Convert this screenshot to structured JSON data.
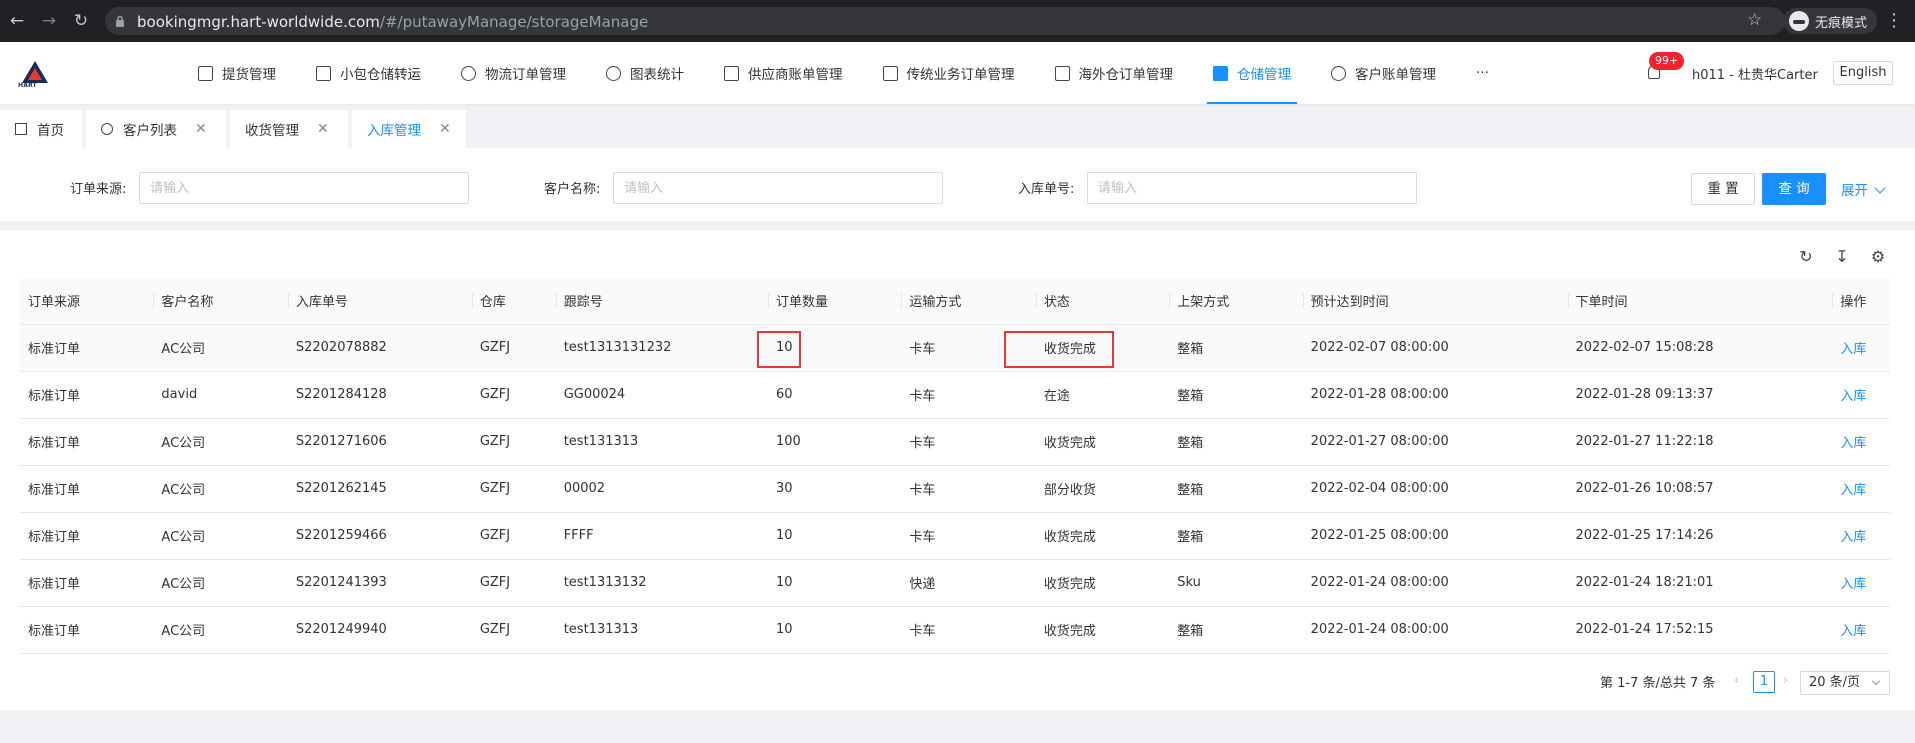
{
  "browser": {
    "url_host": "bookingmgr.hart-worldwide.com",
    "url_path": "/#/putawayManage/storageManage",
    "incognito_label": "无痕模式"
  },
  "header": {
    "logo_text": "HART",
    "nav": [
      {
        "label": "提货管理",
        "icon": "truck-icon"
      },
      {
        "label": "小包仓储转运",
        "icon": "box-icon"
      },
      {
        "label": "物流订单管理",
        "icon": "globe-icon"
      },
      {
        "label": "图表统计",
        "icon": "chart-icon"
      },
      {
        "label": "供应商账单管理",
        "icon": "bill-icon"
      },
      {
        "label": "传统业务订单管理",
        "icon": "network-icon"
      },
      {
        "label": "海外仓订单管理",
        "icon": "home-icon"
      },
      {
        "label": "仓储管理",
        "icon": "warehouse-icon",
        "active": true
      },
      {
        "label": "客户账单管理",
        "icon": "yen-icon"
      }
    ],
    "more": "···",
    "badge": "99+",
    "user": "h011 - 杜贵华Carter",
    "lang": "English"
  },
  "tabs": [
    {
      "label": "首页"
    },
    {
      "label": "客户列表"
    },
    {
      "label": "收货管理"
    },
    {
      "label": "入库管理",
      "active": true
    }
  ],
  "filter": {
    "source_label": "订单来源:",
    "customer_label": "客户名称:",
    "inbound_label": "入库单号:",
    "placeholder": "请输入",
    "reset": "重 置",
    "query": "查 询",
    "expand": "展开"
  },
  "table": {
    "columns": [
      "订单来源",
      "客户名称",
      "入库单号",
      "仓库",
      "跟踪号",
      "订单数量",
      "运输方式",
      "状态",
      "上架方式",
      "预计达到时间",
      "下单时间",
      "操作"
    ],
    "rows": [
      [
        "标准订单",
        "AC公司",
        "S2202078882",
        "GZFJ",
        "test1313131232",
        "10",
        "卡车",
        "收货完成",
        "整箱",
        "2022-02-07 08:00:00",
        "2022-02-07 15:08:28",
        "入库"
      ],
      [
        "标准订单",
        "david",
        "S2201284128",
        "GZFJ",
        "GG00024",
        "60",
        "卡车",
        "在途",
        "整箱",
        "2022-01-28 08:00:00",
        "2022-01-28 09:13:37",
        "入库"
      ],
      [
        "标准订单",
        "AC公司",
        "S2201271606",
        "GZFJ",
        "test131313",
        "100",
        "卡车",
        "收货完成",
        "整箱",
        "2022-01-27 08:00:00",
        "2022-01-27 11:22:18",
        "入库"
      ],
      [
        "标准订单",
        "AC公司",
        "S2201262145",
        "GZFJ",
        "00002",
        "30",
        "卡车",
        "部分收货",
        "整箱",
        "2022-02-04 08:00:00",
        "2022-01-26 10:08:57",
        "入库"
      ],
      [
        "标准订单",
        "AC公司",
        "S2201259466",
        "GZFJ",
        "FFFF",
        "10",
        "卡车",
        "收货完成",
        "整箱",
        "2022-01-25 08:00:00",
        "2022-01-25 17:14:26",
        "入库"
      ],
      [
        "标准订单",
        "AC公司",
        "S2201241393",
        "GZFJ",
        "test1313132",
        "10",
        "快递",
        "收货完成",
        "Sku",
        "2022-01-24 08:00:00",
        "2022-01-24 18:21:01",
        "入库"
      ],
      [
        "标准订单",
        "AC公司",
        "S2201249940",
        "GZFJ",
        "test131313",
        "10",
        "卡车",
        "收货完成",
        "整箱",
        "2022-01-24 08:00:00",
        "2022-01-24 17:52:15",
        "入库"
      ]
    ]
  },
  "pagination": {
    "total": "第 1-7 条/总共 7 条",
    "current": "1",
    "page_size": "20 条/页"
  }
}
